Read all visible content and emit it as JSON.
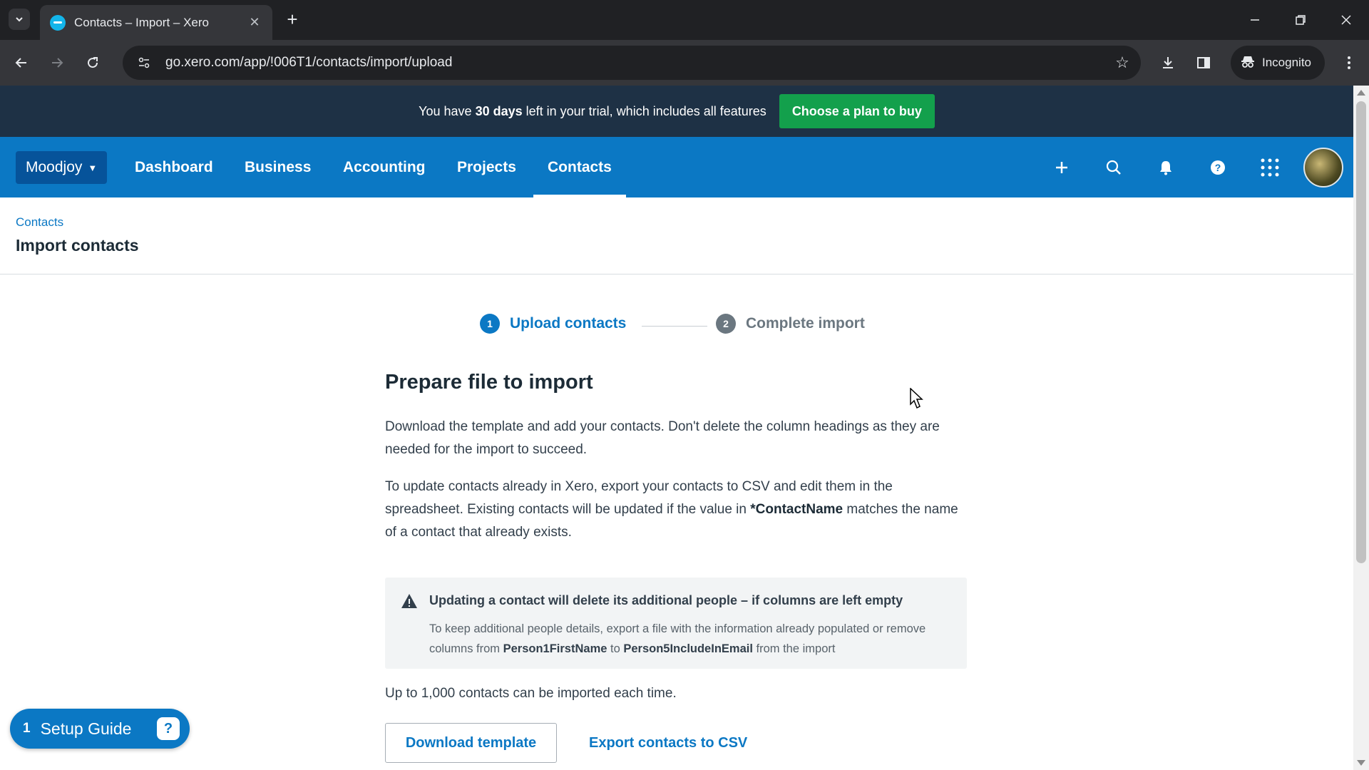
{
  "browser": {
    "tab_title": "Contacts – Import – Xero",
    "url": "go.xero.com/app/!006T1/contacts/import/upload",
    "incognito_label": "Incognito"
  },
  "trial": {
    "text_before": "You have ",
    "days": "30 days",
    "text_after": " left in your trial, which includes all features",
    "button": "Choose a plan to buy"
  },
  "nav": {
    "org": "Moodjoy",
    "items": [
      "Dashboard",
      "Business",
      "Accounting",
      "Projects",
      "Contacts"
    ],
    "active": "Contacts"
  },
  "header": {
    "breadcrumb": "Contacts",
    "title": "Import contacts"
  },
  "stepper": {
    "step1": {
      "num": "1",
      "label": "Upload contacts"
    },
    "step2": {
      "num": "2",
      "label": "Complete import"
    }
  },
  "content": {
    "heading": "Prepare file to import",
    "para1": "Download the template and add your contacts. Don't delete the column headings as they are needed for the import to succeed.",
    "para2_before": "To update contacts already in Xero, export your contacts to CSV and edit them in the spreadsheet. Existing contacts will be updated if the value in ",
    "para2_bold": "*ContactName",
    "para2_after": " matches the name of a contact that already exists.",
    "warning_title": "Updating a contact will delete its additional people – if columns are left empty",
    "warning_before": "To keep additional people details, export a file with the information already populated or remove columns from ",
    "warning_bold1": "Person1FirstName",
    "warning_mid": " to ",
    "warning_bold2": "Person5IncludeInEmail",
    "warning_after": " from the import",
    "limit": "Up to 1,000 contacts can be imported each time.",
    "download_button": "Download template",
    "export_link": "Export contacts to CSV"
  },
  "setup_guide": {
    "count": "1",
    "label": "Setup Guide"
  },
  "colors": {
    "xero_blue": "#0b78c4",
    "banner_navy": "#1e3145",
    "trial_green": "#13a04c",
    "step_inactive": "#6b7780"
  }
}
